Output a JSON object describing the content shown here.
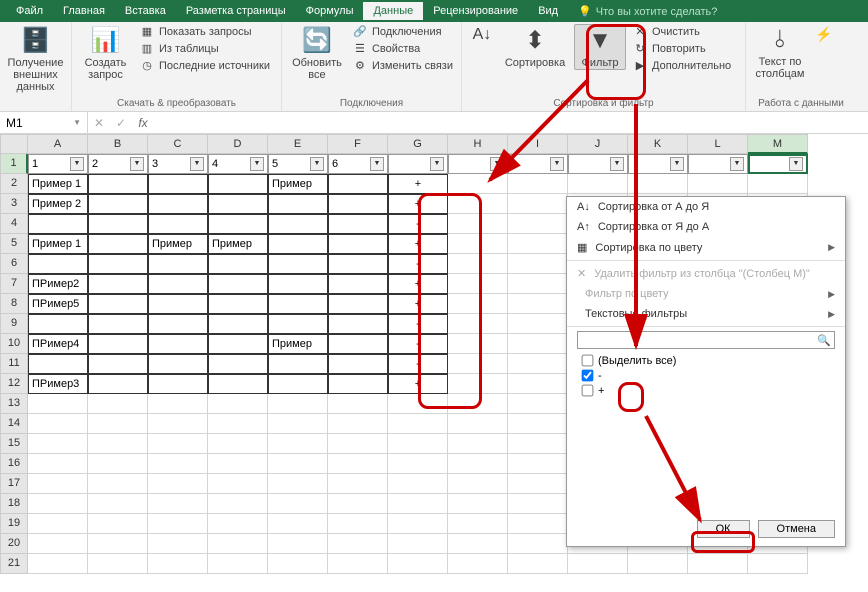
{
  "tabs": {
    "items": [
      "Файл",
      "Главная",
      "Вставка",
      "Разметка страницы",
      "Формулы",
      "Данные",
      "Рецензирование",
      "Вид"
    ],
    "active_index": 5,
    "tell_me": "Что вы хотите сделать?"
  },
  "ribbon": {
    "group1": {
      "btn1": "Получение внешних данных",
      "label": ""
    },
    "group2": {
      "btn_big": "Создать запрос",
      "s1": "Показать запросы",
      "s2": "Из таблицы",
      "s3": "Последние источники",
      "label": "Скачать & преобразовать"
    },
    "group3": {
      "btn_big": "Обновить все",
      "s1": "Подключения",
      "s2": "Свойства",
      "s3": "Изменить связи",
      "label": "Подключения"
    },
    "group4": {
      "btn1": "Сортировка",
      "btn2": "Фильтр",
      "s1": "Очистить",
      "s2": "Повторить",
      "s3": "Дополнительно",
      "label": "Сортировка и фильтр"
    },
    "group5": {
      "btn1": "Текст по столбцам",
      "label": "Работа с данными"
    }
  },
  "name_box": "M1",
  "columns": [
    "A",
    "B",
    "C",
    "D",
    "E",
    "F",
    "G",
    "H",
    "I",
    "J",
    "K",
    "L",
    "M"
  ],
  "filter_headers": [
    "1",
    "2",
    "3",
    "4",
    "5",
    "6",
    "",
    "",
    "",
    "",
    "",
    "",
    ""
  ],
  "selected_col_index": 12,
  "table": {
    "rows": [
      {
        "r": 2,
        "cells": [
          "Пример 1",
          "",
          "",
          "",
          "Пример",
          "",
          "+",
          "",
          "",
          "",
          "",
          "",
          ""
        ],
        "border": true
      },
      {
        "r": 3,
        "cells": [
          "Пример 2",
          "",
          "",
          "",
          "",
          "",
          "+",
          "",
          "",
          "",
          "",
          "",
          ""
        ],
        "border": true
      },
      {
        "r": 4,
        "cells": [
          "",
          "",
          "",
          "",
          "",
          "",
          "-",
          "",
          "",
          "",
          "",
          "",
          ""
        ],
        "border": true
      },
      {
        "r": 5,
        "cells": [
          "Пример 1",
          "",
          "Пример",
          "Пример",
          "",
          "",
          "+",
          "",
          "",
          "",
          "",
          "",
          ""
        ],
        "border": true
      },
      {
        "r": 6,
        "cells": [
          "",
          "",
          "",
          "",
          "",
          "",
          "-",
          "",
          "",
          "",
          "",
          "",
          ""
        ],
        "border": true
      },
      {
        "r": 7,
        "cells": [
          "ПРимер2",
          "",
          "",
          "",
          "",
          "",
          "+",
          "",
          "",
          "",
          "",
          "",
          ""
        ],
        "border": true
      },
      {
        "r": 8,
        "cells": [
          "ПРимер5",
          "",
          "",
          "",
          "",
          "",
          "+",
          "",
          "",
          "",
          "",
          "",
          ""
        ],
        "border": true
      },
      {
        "r": 9,
        "cells": [
          "",
          "",
          "",
          "",
          "",
          "",
          "-",
          "",
          "",
          "",
          "",
          "",
          ""
        ],
        "border": true
      },
      {
        "r": 10,
        "cells": [
          "ПРимер4",
          "",
          "",
          "",
          "Пример",
          "",
          "-",
          "",
          "",
          "",
          "",
          "",
          ""
        ],
        "border": true
      },
      {
        "r": 11,
        "cells": [
          "",
          "",
          "",
          "",
          "",
          "",
          "-",
          "",
          "",
          "",
          "",
          "",
          ""
        ],
        "border": true
      },
      {
        "r": 12,
        "cells": [
          "ПРимер3",
          "",
          "",
          "",
          "",
          "",
          "+",
          "",
          "",
          "",
          "",
          "",
          ""
        ],
        "border": true
      },
      {
        "r": 13,
        "cells": [
          "",
          "",
          "",
          "",
          "",
          "",
          "",
          "",
          "",
          "",
          "",
          "",
          ""
        ]
      },
      {
        "r": 14,
        "cells": [
          "",
          "",
          "",
          "",
          "",
          "",
          "",
          "",
          "",
          "",
          "",
          "",
          ""
        ]
      },
      {
        "r": 15,
        "cells": [
          "",
          "",
          "",
          "",
          "",
          "",
          "",
          "",
          "",
          "",
          "",
          "",
          ""
        ]
      },
      {
        "r": 16,
        "cells": [
          "",
          "",
          "",
          "",
          "",
          "",
          "",
          "",
          "",
          "",
          "",
          "",
          ""
        ]
      },
      {
        "r": 17,
        "cells": [
          "",
          "",
          "",
          "",
          "",
          "",
          "",
          "",
          "",
          "",
          "",
          "",
          ""
        ]
      },
      {
        "r": 18,
        "cells": [
          "",
          "",
          "",
          "",
          "",
          "",
          "",
          "",
          "",
          "",
          "",
          "",
          ""
        ]
      },
      {
        "r": 19,
        "cells": [
          "",
          "",
          "",
          "",
          "",
          "",
          "",
          "",
          "",
          "",
          "",
          "",
          ""
        ]
      },
      {
        "r": 20,
        "cells": [
          "",
          "",
          "",
          "",
          "",
          "",
          "",
          "",
          "",
          "",
          "",
          "",
          ""
        ]
      },
      {
        "r": 21,
        "cells": [
          "",
          "",
          "",
          "",
          "",
          "",
          "",
          "",
          "",
          "",
          "",
          "",
          ""
        ]
      }
    ]
  },
  "filter_panel": {
    "sort_az": "Сортировка от А до Я",
    "sort_za": "Сортировка от Я до А",
    "sort_color": "Сортировка по цвету",
    "clear_filter": "Удалить фильтр из столбца \"(Столбец M)\"",
    "filter_color": "Фильтр по цвету",
    "text_filters": "Текстовые фильтры",
    "search_placeholder": "",
    "select_all": "(Выделить все)",
    "opt_minus": "-",
    "opt_plus": "+",
    "ok": "ОК",
    "cancel": "Отмена"
  }
}
